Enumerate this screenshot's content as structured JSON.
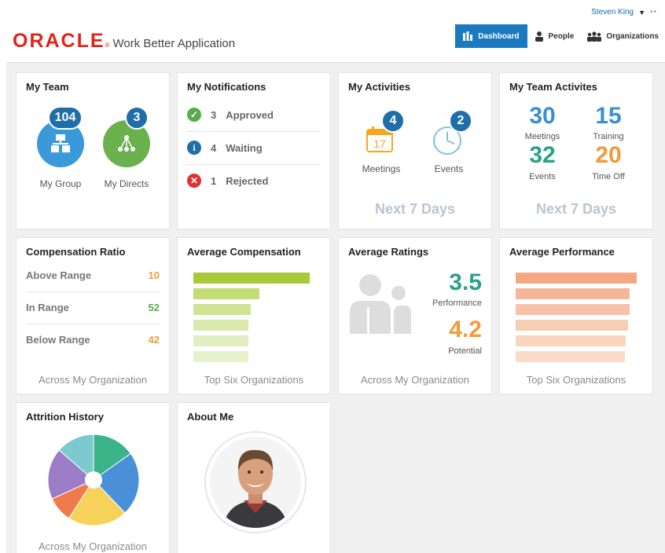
{
  "header": {
    "user_name": "Steven King",
    "brand": "ORACLE",
    "reg_mark": "®",
    "app_name": "Work Better Application",
    "nav": {
      "dashboard": "Dashboard",
      "people": "People",
      "organizations": "Organizations"
    },
    "active_nav": "Dashboard"
  },
  "colors": {
    "oracle_red": "#e2231a",
    "nav_active": "#1b79c0",
    "badge_blue": "#1f6ea8",
    "green": "#5aab4e",
    "orange": "#f39a3c",
    "teal": "#2aa18a",
    "blue_num": "#3a8fd1"
  },
  "cards": {
    "my_team": {
      "title": "My Team",
      "group_count": "104",
      "directs_count": "3",
      "group_label": "My Group",
      "directs_label": "My Directs"
    },
    "notifications": {
      "title": "My Notifications",
      "items": [
        {
          "count": "3",
          "label": "Approved",
          "icon": "check-icon"
        },
        {
          "count": "4",
          "label": "Waiting",
          "icon": "info-icon"
        },
        {
          "count": "1",
          "label": "Rejected",
          "icon": "x-icon"
        }
      ]
    },
    "activities": {
      "title": "My Activities",
      "meetings_count": "4",
      "events_count": "2",
      "calendar_day": "17",
      "meetings_label": "Meetings",
      "events_label": "Events",
      "footer": "Next 7 Days"
    },
    "team_activities": {
      "title": "My Team Activites",
      "stats": [
        {
          "value": "30",
          "label": "Meetings"
        },
        {
          "value": "15",
          "label": "Training"
        },
        {
          "value": "32",
          "label": "Events"
        },
        {
          "value": "20",
          "label": "Time Off"
        }
      ],
      "footer": "Next 7 Days"
    },
    "comp_ratio": {
      "title": "Compensation Ratio",
      "rows": [
        {
          "label": "Above Range",
          "value": "10"
        },
        {
          "label": "In Range",
          "value": "52"
        },
        {
          "label": "Below Range",
          "value": "42"
        }
      ],
      "footer": "Across My Organization"
    },
    "avg_comp": {
      "title": "Average Compensation",
      "bars": [
        1.0,
        0.57,
        0.49,
        0.47,
        0.47,
        0.47
      ],
      "footer": "Top Six Organizations"
    },
    "avg_ratings": {
      "title": "Average Ratings",
      "performance": "3.5",
      "performance_label": "Performance",
      "potential": "4.2",
      "potential_label": "Potential",
      "footer": "Across My Organization"
    },
    "avg_perf": {
      "title": "Average Performance",
      "bars": [
        1.0,
        0.94,
        0.94,
        0.93,
        0.91,
        0.9
      ],
      "footer": "Top Six Organizations"
    },
    "attrition": {
      "title": "Attrition History",
      "slices": [
        {
          "value": 1,
          "color": "#3db38a"
        },
        {
          "value": 1.5,
          "color": "#4a90d9"
        },
        {
          "value": 1.4,
          "color": "#f7d25a"
        },
        {
          "value": 0.6,
          "color": "#f07a4a"
        },
        {
          "value": 1.2,
          "color": "#9b7cc7"
        },
        {
          "value": 0.9,
          "color": "#7cc9cf"
        }
      ],
      "footer": "Across My Organization"
    },
    "about_me": {
      "title": "About Me"
    }
  }
}
